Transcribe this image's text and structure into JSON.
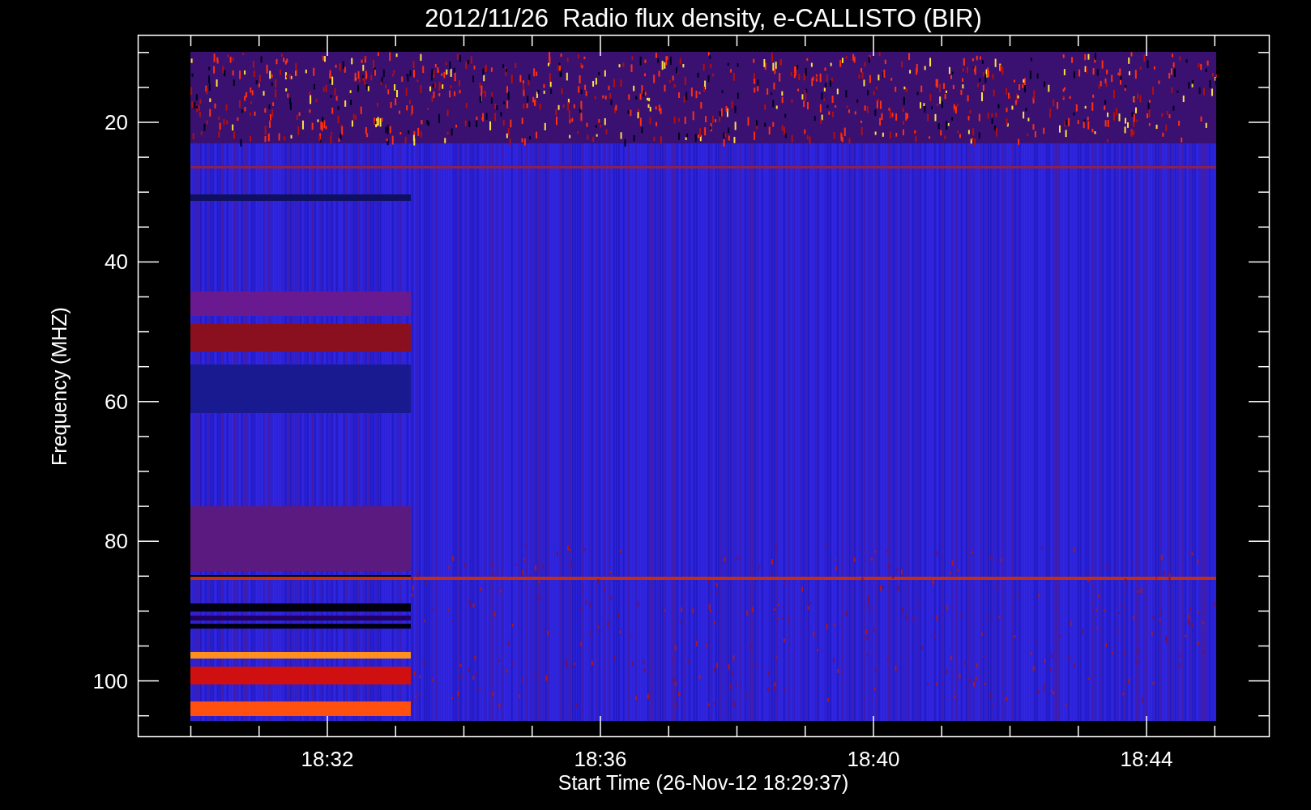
{
  "title": "2012/11/26  Radio flux density, e-CALLISTO (BIR)",
  "ylabel": "Frequency (MHZ)",
  "xlabel": "Start Time (26-Nov-12 18:29:37)",
  "yticks": [
    "20",
    "40",
    "60",
    "80",
    "100"
  ],
  "xticks": [
    "18:32",
    "18:36",
    "18:40",
    "18:44"
  ]
}
